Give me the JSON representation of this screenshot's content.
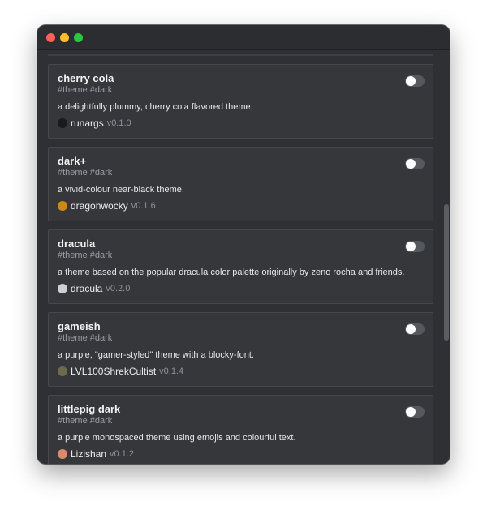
{
  "window": {
    "buttons": [
      "close",
      "minimize",
      "maximize"
    ]
  },
  "themes": [
    {
      "title": "cherry cola",
      "tags": "#theme #dark",
      "description": "a delightfully plummy, cherry cola flavored theme.",
      "author": "runargs",
      "version": "v0.1.0",
      "avatar_icon": "avatar-runargs-icon",
      "avatar_color": "#1a1a1a",
      "enabled": false
    },
    {
      "title": "dark+",
      "tags": "#theme #dark",
      "description": "a vivid-colour near-black theme.",
      "author": "dragonwocky",
      "version": "v0.1.6",
      "avatar_icon": "avatar-dragonwocky-icon",
      "avatar_color": "#c98a1a",
      "enabled": false
    },
    {
      "title": "dracula",
      "tags": "#theme #dark",
      "description": "a theme based on the popular dracula color palette originally by zeno rocha and friends.",
      "author": "dracula",
      "version": "v0.2.0",
      "avatar_icon": "avatar-dracula-icon",
      "avatar_color": "#cfcfd4",
      "enabled": false
    },
    {
      "title": "gameish",
      "tags": "#theme #dark",
      "description": "a purple, \"gamer-styled\" theme with a blocky-font.",
      "author": "LVL100ShrekCultist",
      "version": "v0.1.4",
      "avatar_icon": "avatar-lvl100shrekcultist-icon",
      "avatar_color": "#6b6a4a",
      "enabled": false
    },
    {
      "title": "littlepig dark",
      "tags": "#theme #dark",
      "description": "a purple monospaced theme using emojis and colourful text.",
      "author": "Lizishan",
      "version": "v0.1.2",
      "avatar_icon": "avatar-lizishan-icon",
      "avatar_color": "#d98a6a",
      "enabled": false
    }
  ]
}
